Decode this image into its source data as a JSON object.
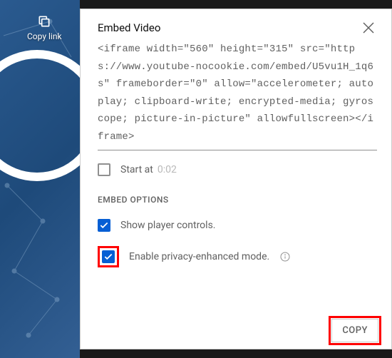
{
  "sidebar": {
    "copy_link_label": "Copy link"
  },
  "panel": {
    "title": "Embed Video",
    "embed_code": "<iframe width=\"560\" height=\"315\" src=\"https://www.youtube-nocookie.com/embed/U5vu1H_1q6s\" frameborder=\"0\" allow=\"accelerometer; autoplay; clipboard-write; encrypted-media; gyroscope; picture-in-picture\" allowfullscreen></iframe>",
    "start_at_label": "Start at",
    "start_at_time": "0:02",
    "options_heading": "EMBED OPTIONS",
    "option_controls": "Show player controls.",
    "option_privacy": "Enable privacy-enhanced mode.",
    "copy_button": "COPY"
  },
  "state": {
    "start_at_checked": false,
    "controls_checked": true,
    "privacy_checked": true
  },
  "colors": {
    "accent": "#065fd4",
    "highlight": "#ff0000"
  }
}
